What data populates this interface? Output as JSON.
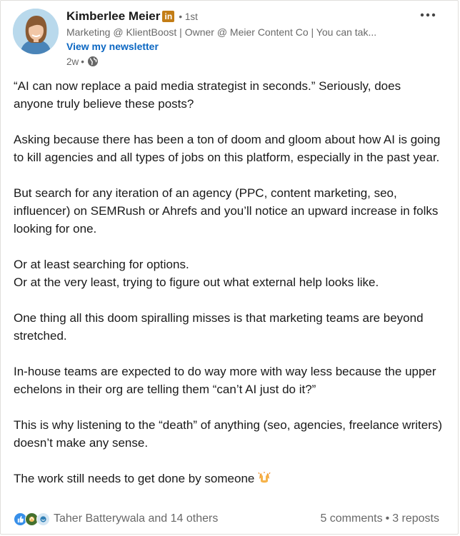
{
  "author": {
    "name": "Kimberlee Meier",
    "degree": "1st",
    "headline": "Marketing @ KlientBoost | Owner @ Meier Content Co | You can tak...",
    "newsletter_link": "View my newsletter",
    "time": "2w",
    "visibility_icon": "globe-icon",
    "badge_icon": "linkedin-premium-badge-icon"
  },
  "post": {
    "paragraphs": [
      [
        "“AI can now replace a paid media strategist in seconds.” Seriously, does anyone truly believe these posts?"
      ],
      [
        "Asking because there has been a ton of doom and gloom about how AI is going to kill agencies and all types of jobs on this platform, especially in the past year."
      ],
      [
        "But search for any iteration of an agency (PPC, content marketing, seo, influencer) on SEMRush or Ahrefs and you’ll notice an upward increase in folks looking for one."
      ],
      [
        "Or at least searching for options.",
        "Or at the very least, trying to figure out what external help looks like."
      ],
      [
        "One thing all this doom spiralling misses is that marketing teams are beyond stretched."
      ],
      [
        "In-house teams are expected to do way more with way less because the upper echelons in their org are telling them “can’t AI just do it?”"
      ],
      [
        "This is why listening to the “death” of anything (seo, agencies, freelance writers) doesn’t make any sense."
      ],
      [
        "The work still needs to get done by someone"
      ]
    ],
    "closing_emoji": "raising-hands-emoji"
  },
  "social": {
    "reaction_icons": [
      "like-reaction-icon",
      "celebrate-reaction-icon",
      "support-reaction-icon"
    ],
    "reactors": "Taher Batterywala and 14 others",
    "comments": "5 comments",
    "separator": "•",
    "reposts": "3 reposts"
  },
  "colors": {
    "link": "#0a66c2",
    "premium_badge": "#c37d16",
    "secondary_text": "#666666"
  }
}
